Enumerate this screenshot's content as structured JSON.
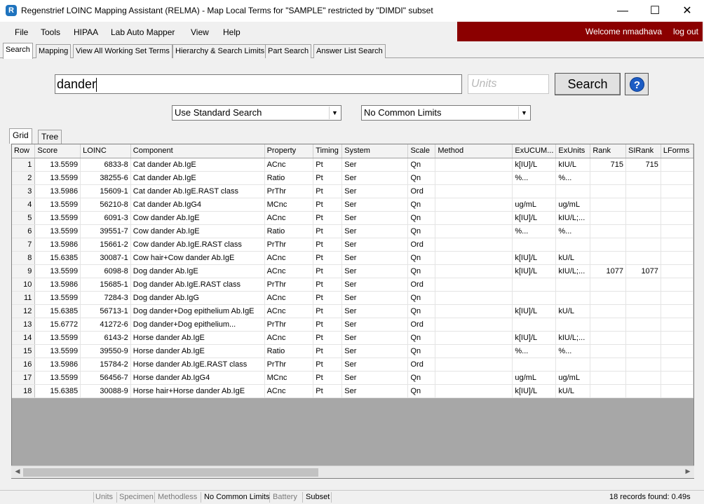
{
  "window": {
    "title": "Regenstrief LOINC Mapping Assistant (RELMA) - Map Local Terms  for \"SAMPLE\" restricted by \"DIMDI\" subset",
    "minimize": "—",
    "maximize": "☐",
    "close": "✕"
  },
  "menu": [
    "File",
    "Tools",
    "HIPAA",
    "Lab Auto Mapper",
    "View",
    "Help"
  ],
  "user": {
    "welcome": "Welcome nmadhava",
    "logout": "log out"
  },
  "tabs": [
    "Search",
    "Mapping",
    "View All Working Set Terms",
    "Hierarchy & Search Limits",
    "Part Search",
    "Answer List Search"
  ],
  "search": {
    "query": "dander",
    "units_placeholder": "Units",
    "button": "Search",
    "help": "?",
    "search_mode": "Use Standard Search",
    "limits": "No Common Limits"
  },
  "view_tabs": [
    "Grid",
    "Tree"
  ],
  "grid": {
    "columns": [
      "Row",
      "Score",
      "LOINC",
      "Component",
      "Property",
      "Timing",
      "System",
      "Scale",
      "Method",
      "ExUCUM...",
      "ExUnits",
      "Rank",
      "SIRank",
      "LForms"
    ],
    "rows": [
      [
        "1",
        "13.5599",
        "6833-8",
        "Cat dander Ab.IgE",
        "ACnc",
        "Pt",
        "Ser",
        "Qn",
        "",
        "k[IU]/L",
        "kIU/L",
        "715",
        "715",
        ""
      ],
      [
        "2",
        "13.5599",
        "38255-6",
        "Cat dander Ab.IgE",
        "Ratio",
        "Pt",
        "Ser",
        "Qn",
        "",
        "%...",
        "%...",
        "",
        "",
        ""
      ],
      [
        "3",
        "13.5986",
        "15609-1",
        "Cat dander Ab.IgE.RAST class",
        "PrThr",
        "Pt",
        "Ser",
        "Ord",
        "",
        "",
        "",
        "",
        "",
        ""
      ],
      [
        "4",
        "13.5599",
        "56210-8",
        "Cat dander Ab.IgG4",
        "MCnc",
        "Pt",
        "Ser",
        "Qn",
        "",
        "ug/mL",
        "ug/mL",
        "",
        "",
        ""
      ],
      [
        "5",
        "13.5599",
        "6091-3",
        "Cow dander Ab.IgE",
        "ACnc",
        "Pt",
        "Ser",
        "Qn",
        "",
        "k[IU]/L",
        "kIU/L;...",
        "",
        "",
        ""
      ],
      [
        "6",
        "13.5599",
        "39551-7",
        "Cow dander Ab.IgE",
        "Ratio",
        "Pt",
        "Ser",
        "Qn",
        "",
        "%...",
        "%...",
        "",
        "",
        ""
      ],
      [
        "7",
        "13.5986",
        "15661-2",
        "Cow dander Ab.IgE.RAST class",
        "PrThr",
        "Pt",
        "Ser",
        "Ord",
        "",
        "",
        "",
        "",
        "",
        ""
      ],
      [
        "8",
        "15.6385",
        "30087-1",
        "Cow hair+Cow dander Ab.IgE",
        "ACnc",
        "Pt",
        "Ser",
        "Qn",
        "",
        "k[IU]/L",
        "kU/L",
        "",
        "",
        ""
      ],
      [
        "9",
        "13.5599",
        "6098-8",
        "Dog dander Ab.IgE",
        "ACnc",
        "Pt",
        "Ser",
        "Qn",
        "",
        "k[IU]/L",
        "kIU/L;...",
        "1077",
        "1077",
        ""
      ],
      [
        "10",
        "13.5986",
        "15685-1",
        "Dog dander Ab.IgE.RAST class",
        "PrThr",
        "Pt",
        "Ser",
        "Ord",
        "",
        "",
        "",
        "",
        "",
        ""
      ],
      [
        "11",
        "13.5599",
        "7284-3",
        "Dog dander Ab.IgG",
        "ACnc",
        "Pt",
        "Ser",
        "Qn",
        "",
        "",
        "",
        "",
        "",
        ""
      ],
      [
        "12",
        "15.6385",
        "56713-1",
        "Dog dander+Dog epithelium Ab.IgE",
        "ACnc",
        "Pt",
        "Ser",
        "Qn",
        "",
        "k[IU]/L",
        "kU/L",
        "",
        "",
        ""
      ],
      [
        "13",
        "15.6772",
        "41272-6",
        "Dog dander+Dog epithelium...",
        "PrThr",
        "Pt",
        "Ser",
        "Ord",
        "",
        "",
        "",
        "",
        "",
        ""
      ],
      [
        "14",
        "13.5599",
        "6143-2",
        "Horse dander Ab.IgE",
        "ACnc",
        "Pt",
        "Ser",
        "Qn",
        "",
        "k[IU]/L",
        "kIU/L;...",
        "",
        "",
        ""
      ],
      [
        "15",
        "13.5599",
        "39550-9",
        "Horse dander Ab.IgE",
        "Ratio",
        "Pt",
        "Ser",
        "Qn",
        "",
        "%...",
        "%...",
        "",
        "",
        ""
      ],
      [
        "16",
        "13.5986",
        "15784-2",
        "Horse dander Ab.IgE.RAST class",
        "PrThr",
        "Pt",
        "Ser",
        "Ord",
        "",
        "",
        "",
        "",
        "",
        ""
      ],
      [
        "17",
        "13.5599",
        "56456-7",
        "Horse dander Ab.IgG4",
        "MCnc",
        "Pt",
        "Ser",
        "Qn",
        "",
        "ug/mL",
        "ug/mL",
        "",
        "",
        ""
      ],
      [
        "18",
        "15.6385",
        "30088-9",
        "Horse hair+Horse dander Ab.IgE",
        "ACnc",
        "Pt",
        "Ser",
        "Qn",
        "",
        "k[IU]/L",
        "kU/L",
        "",
        "",
        ""
      ]
    ]
  },
  "status": {
    "items": [
      "Units",
      "Specimen",
      "Methodless",
      "No Common Limits",
      "Battery",
      "Subset"
    ],
    "records": "18 records found: 0.49s"
  },
  "colors": {
    "welcome_bar": "#8b0000",
    "help_icon": "#1c5cc4"
  }
}
